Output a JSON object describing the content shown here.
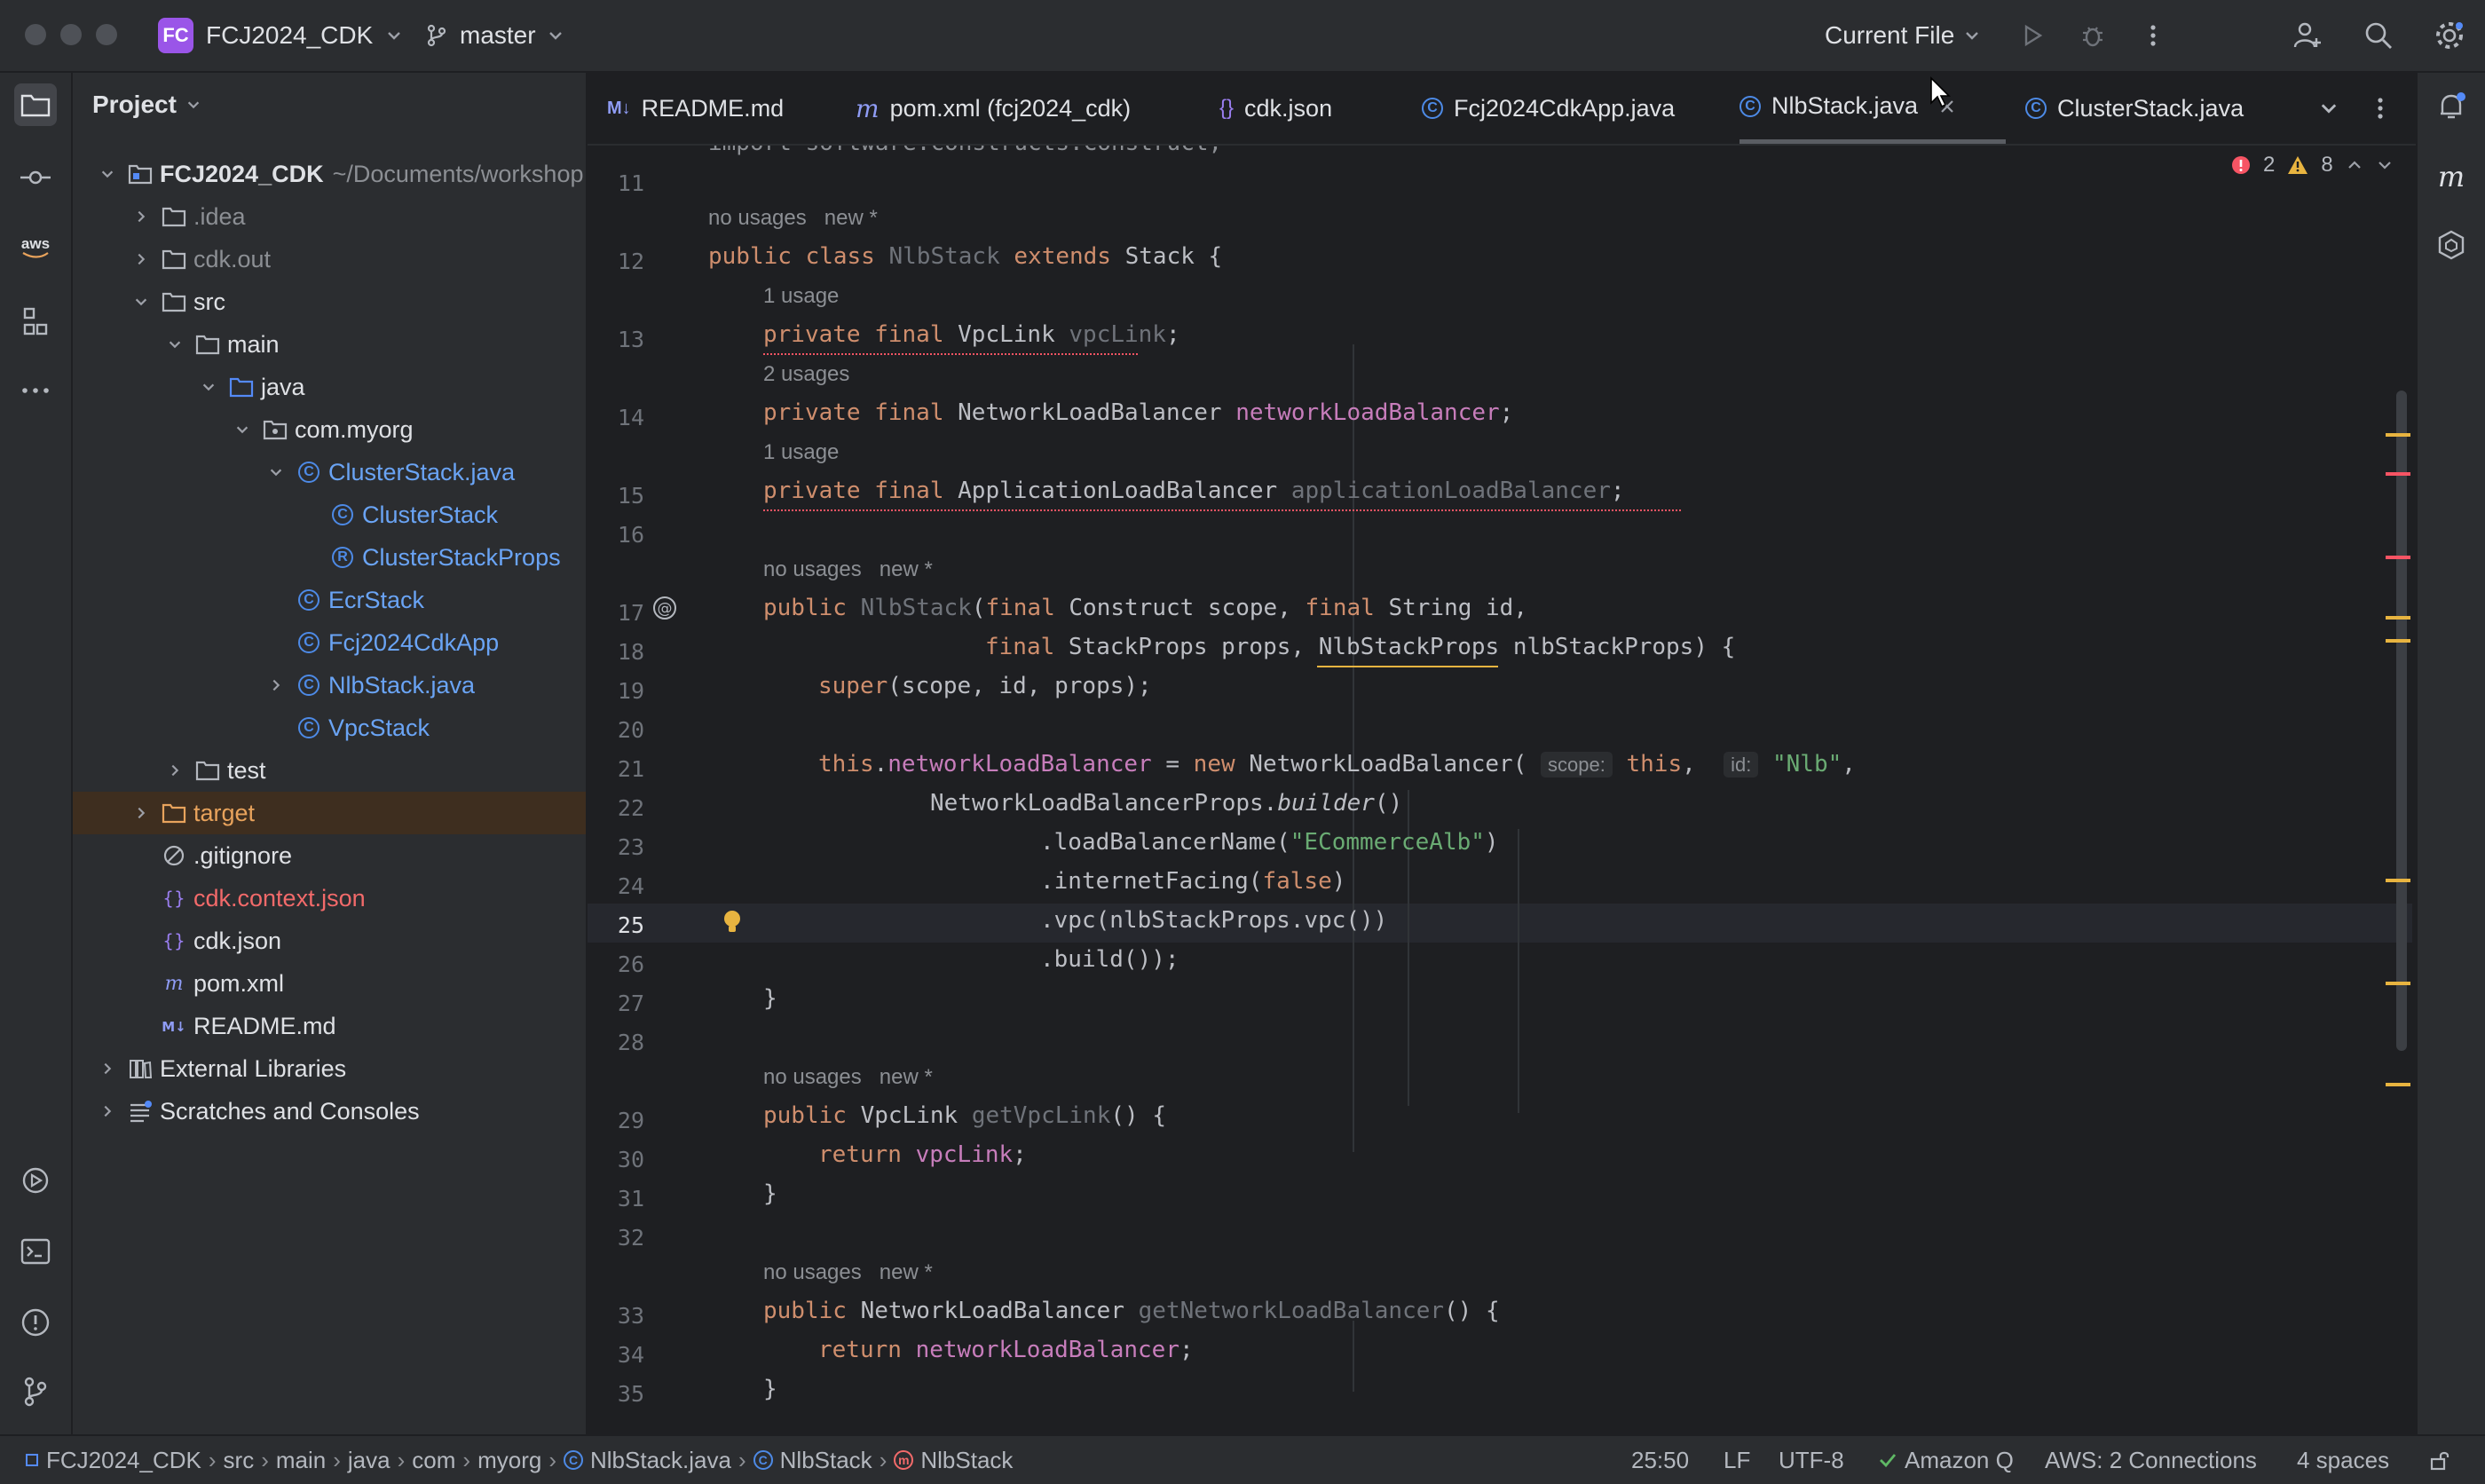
{
  "titlebar": {
    "project_badge": "FC",
    "project_name": "FCJ2024_CDK",
    "branch": "master",
    "run_config": "Current File"
  },
  "project_panel": {
    "title": "Project",
    "root_name": "FCJ2024_CDK",
    "root_path": "~/Documents/workshop",
    "items": [
      {
        "label": ".idea"
      },
      {
        "label": "cdk.out"
      },
      {
        "label": "src"
      },
      {
        "label": "main"
      },
      {
        "label": "java"
      },
      {
        "label": "com.myorg"
      },
      {
        "label": "ClusterStack.java"
      },
      {
        "label": "ClusterStack"
      },
      {
        "label": "ClusterStackProps"
      },
      {
        "label": "EcrStack"
      },
      {
        "label": "Fcj2024CdkApp"
      },
      {
        "label": "NlbStack.java"
      },
      {
        "label": "VpcStack"
      },
      {
        "label": "test"
      },
      {
        "label": "target"
      },
      {
        "label": ".gitignore"
      },
      {
        "label": "cdk.context.json"
      },
      {
        "label": "cdk.json"
      },
      {
        "label": "pom.xml"
      },
      {
        "label": "README.md"
      },
      {
        "label": "External Libraries"
      },
      {
        "label": "Scratches and Consoles"
      }
    ]
  },
  "tabs": [
    {
      "label": "README.md",
      "icon": "M↓"
    },
    {
      "label": "pom.xml (fcj2024_cdk)",
      "icon": "m"
    },
    {
      "label": "cdk.json",
      "icon": "{}"
    },
    {
      "label": "Fcj2024CdkApp.java",
      "icon": "C"
    },
    {
      "label": "NlbStack.java",
      "icon": "C"
    },
    {
      "label": "ClusterStack.java",
      "icon": "C"
    }
  ],
  "inspections": {
    "errors": "2",
    "warnings": "8"
  },
  "editor": {
    "line_numbers": [
      "11",
      "12",
      "13",
      "14",
      "15",
      "16",
      "17",
      "18",
      "19",
      "20",
      "21",
      "22",
      "23",
      "24",
      "25",
      "26",
      "27",
      "28",
      "29",
      "30",
      "31",
      "32",
      "33",
      "34",
      "35"
    ],
    "hints": {
      "no_usages": "no usages",
      "new": "new *",
      "one_usage": "1 usage",
      "two_usages": "2 usages"
    },
    "top_fragment": "import software.constructs.Construct;",
    "inlay_scope": "scope:",
    "inlay_id": "id:"
  },
  "statusbar": {
    "breadcrumbs": [
      "FCJ2024_CDK",
      "src",
      "main",
      "java",
      "com",
      "myorg",
      "NlbStack.java",
      "NlbStack",
      "NlbStack"
    ],
    "position": "25:50",
    "line_sep": "LF",
    "encoding": "UTF-8",
    "amazon_q": "Amazon Q",
    "aws": "AWS: 2 Connections",
    "indent": "4 spaces"
  },
  "colors": {
    "accent": "#548af7",
    "background": "#1e1f22",
    "panel": "#2b2d30",
    "keyword": "#cf8e6d",
    "field": "#c77dbb",
    "string": "#6aab73",
    "error": "#f75464",
    "warning": "#e8b440"
  }
}
